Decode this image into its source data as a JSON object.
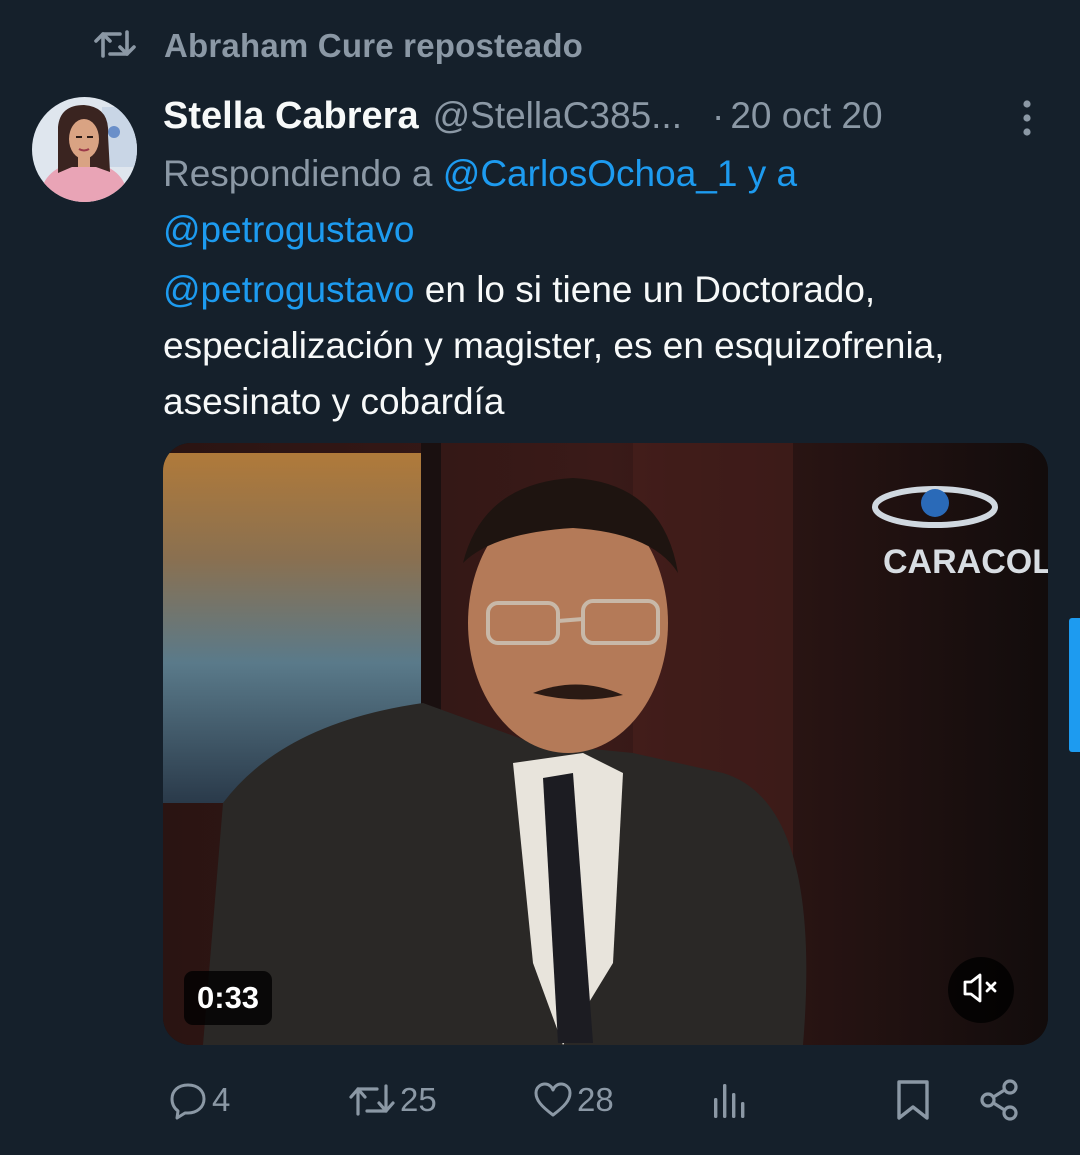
{
  "repost": {
    "label": "Abraham Cure reposteado",
    "icon": "retweet-icon"
  },
  "tweet": {
    "author_name": "Stella Cabrera",
    "author_handle": "@StellaC385...",
    "date_separator": "·",
    "date": "20 oct 20",
    "reply_prefix": "Respondiendo a",
    "reply_to_1": "@CarlosOchoa_1",
    "reply_joiner": "y a",
    "reply_to_2": "@petrogustavo",
    "text_mention": "@petrogustavo",
    "text_body": "en lo  si tiene un Doctorado, especialización y magister, es en esquizofrenia, asesinato y cobardía"
  },
  "video": {
    "duration": "0:33",
    "muted_icon": "volume-muted-icon",
    "watermark": "CARACOL"
  },
  "actions": {
    "reply_count": "4",
    "repost_count": "25",
    "like_count": "28"
  },
  "colors": {
    "background": "#15202b",
    "muted_text": "#8b98a5",
    "link": "#1d9bf0",
    "primary_text": "#f7f9f9"
  }
}
